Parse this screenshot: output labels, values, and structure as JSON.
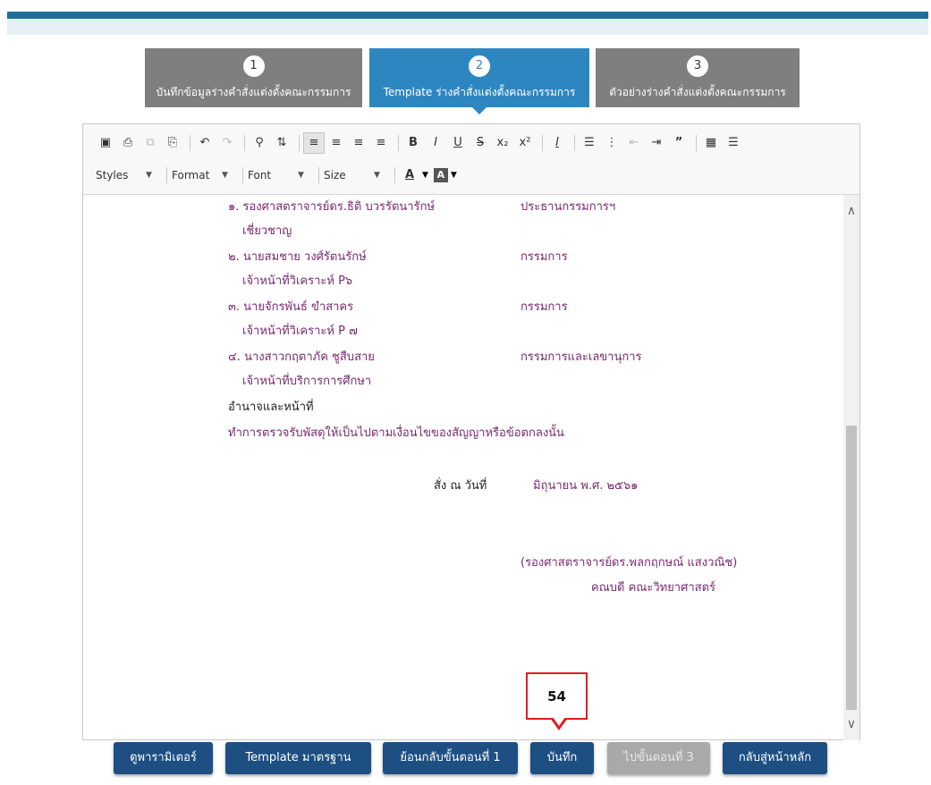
{
  "steps": [
    {
      "number": "1",
      "label": "บันทึกข้อมูลร่างคำสั่งแต่งตั้งคณะกรรมการ",
      "active": false
    },
    {
      "number": "2",
      "label": "Template ร่างคำสั่งแต่งตั้งคณะกรรมการ",
      "active": true
    },
    {
      "number": "3",
      "label": "ตัวอย่างร่างคำสั่งแต่งตั้งคณะกรรมการ",
      "active": false
    }
  ],
  "toolbar": {
    "styles_label": "Styles",
    "format_label": "Format",
    "font_label": "Font",
    "size_label": "Size",
    "icons": [
      "preview-icon",
      "print-icon",
      "copy-icon",
      "paste-icon",
      "undo-icon",
      "redo-icon",
      "find-icon",
      "replace-icon",
      "align-left-icon",
      "align-center-icon",
      "align-right-icon",
      "justify-icon",
      "bold-icon",
      "italic-icon",
      "underline-icon",
      "strike-icon",
      "subscript-icon",
      "superscript-icon",
      "remove-format-icon",
      "numbered-list-icon",
      "bulleted-list-icon",
      "outdent-icon",
      "indent-icon",
      "blockquote-icon",
      "table-icon",
      "show-blocks-icon",
      "text-color-icon",
      "bg-color-icon"
    ]
  },
  "document": {
    "members": [
      {
        "name": "๑. รองศาสตราจารย์ดร.ธิติ บวรรัตนารักษ์",
        "role": "ประธานกรรมการฯ",
        "position": "เชี่ยวชาญ"
      },
      {
        "name": "๒. นายสมชาย วงศ์รัตนรักษ์",
        "role": "กรรมการ",
        "position": "เจ้าหน้าที่วิเคราะห์ P๖"
      },
      {
        "name": "๓. นายจักรพันธ์ ขำสาคร",
        "role": "กรรมการ",
        "position": "เจ้าหน้าที่วิเคราะห์ P ๗"
      },
      {
        "name": "๔. นางสาวกฤตาภัค ชูสืบสาย",
        "role": "กรรมการและเลขานุการ",
        "position": "เจ้าหน้าที่บริการการศึกษา"
      }
    ],
    "duties_heading": "อำนาจและหน้าที่",
    "duties_text": "ทำการตรวจรับพัสดุให้เป็นไปตามเงื่อนไขของสัญญาหรือข้อตกลงนั้น",
    "order_date_label": "สั่ง ณ วันที่",
    "order_date_value": "มิถุนายน พ.ศ. ๒๕๖๑",
    "signer_name": "(รองศาสตราจารย์ดร.พลกฤกษณ์ แสงวณิช)",
    "signer_title": "คณบดี คณะวิทยาศาสตร์"
  },
  "callout": {
    "number": "54",
    "color": "#e41b1b"
  },
  "buttons": [
    {
      "label": "ดูพารามิเตอร์",
      "disabled": false
    },
    {
      "label": "Template มาตรฐาน",
      "disabled": false
    },
    {
      "label": "ย้อนกลับขั้นตอนที่ 1",
      "disabled": false
    },
    {
      "label": "บันทึก",
      "disabled": false
    },
    {
      "label": "ไปขั้นตอนที่ 3",
      "disabled": true
    },
    {
      "label": "กลับสู่หน้าหลัก",
      "disabled": false
    }
  ],
  "colors": {
    "primary": "#1d4f82",
    "step_active": "#2e86c1",
    "step_inactive": "#7f7f7f",
    "doc_text": "#7a2970"
  }
}
